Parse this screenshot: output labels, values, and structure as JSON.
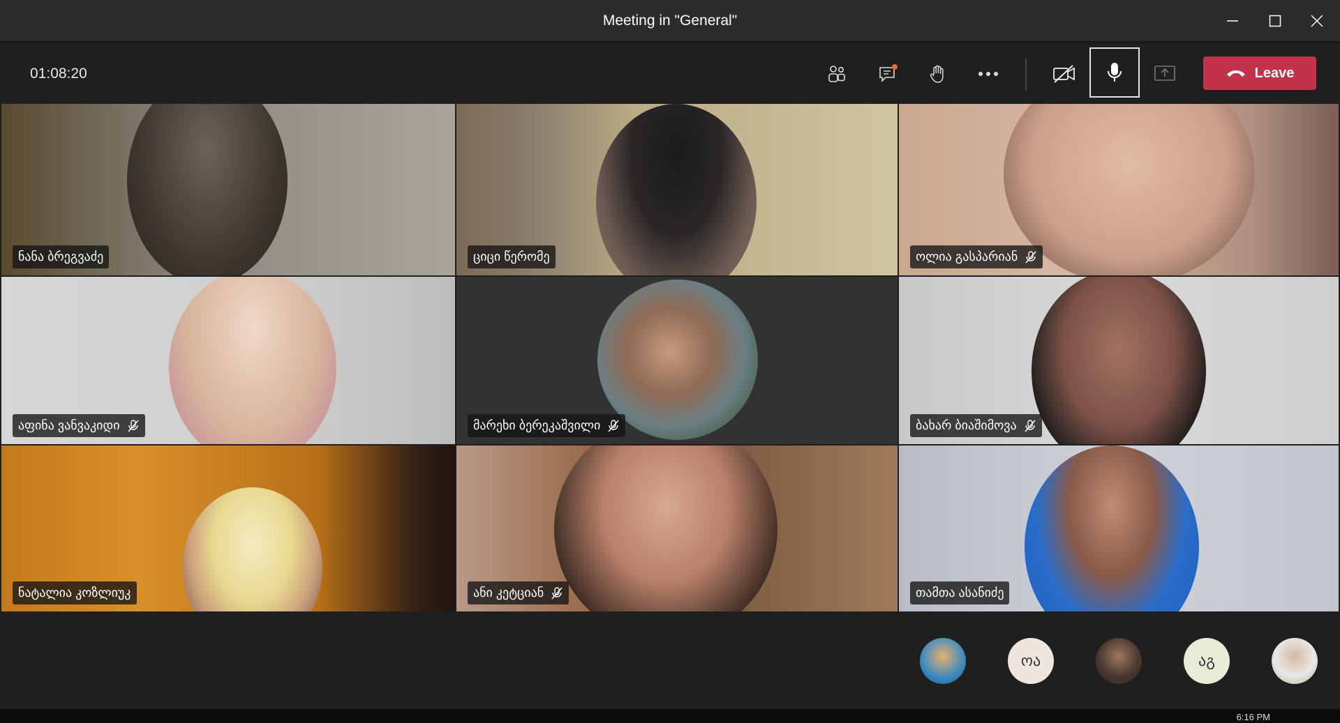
{
  "window": {
    "title": "Meeting in \"General\""
  },
  "toolbar": {
    "timer": "01:08:20",
    "buttons": [
      "people-icon",
      "chat-icon",
      "raise-hand-icon",
      "more-icon",
      "camera-off-icon",
      "microphone-icon",
      "share-screen-icon"
    ],
    "leave_label": "Leave",
    "leave_color": "#c4314b"
  },
  "participants": [
    {
      "name": "ნანა ბრეგვაძე",
      "muted": false
    },
    {
      "name": "ციცი წერომე",
      "muted": false
    },
    {
      "name": "ოლია გასპარიან",
      "muted": true
    },
    {
      "name": "აფინა ვანვაკიდი",
      "muted": true
    },
    {
      "name": "მარეხი ბერეკაშვილი",
      "muted": true
    },
    {
      "name": "ბახარ ბიაშიმოვა",
      "muted": true
    },
    {
      "name": "ნატალია კოზლიუკ",
      "muted": false
    },
    {
      "name": "ანი კეტციან",
      "muted": true
    },
    {
      "name": "თამთა ასანიძე",
      "muted": false
    }
  ],
  "roster": {
    "avatars": [
      {
        "type": "photo",
        "initials": ""
      },
      {
        "type": "initials",
        "initials": "ოა"
      },
      {
        "type": "photo",
        "initials": ""
      },
      {
        "type": "initials",
        "initials": "აგ"
      },
      {
        "type": "photo",
        "initials": ""
      }
    ]
  },
  "taskbar": {
    "clock": "6:16 PM"
  }
}
